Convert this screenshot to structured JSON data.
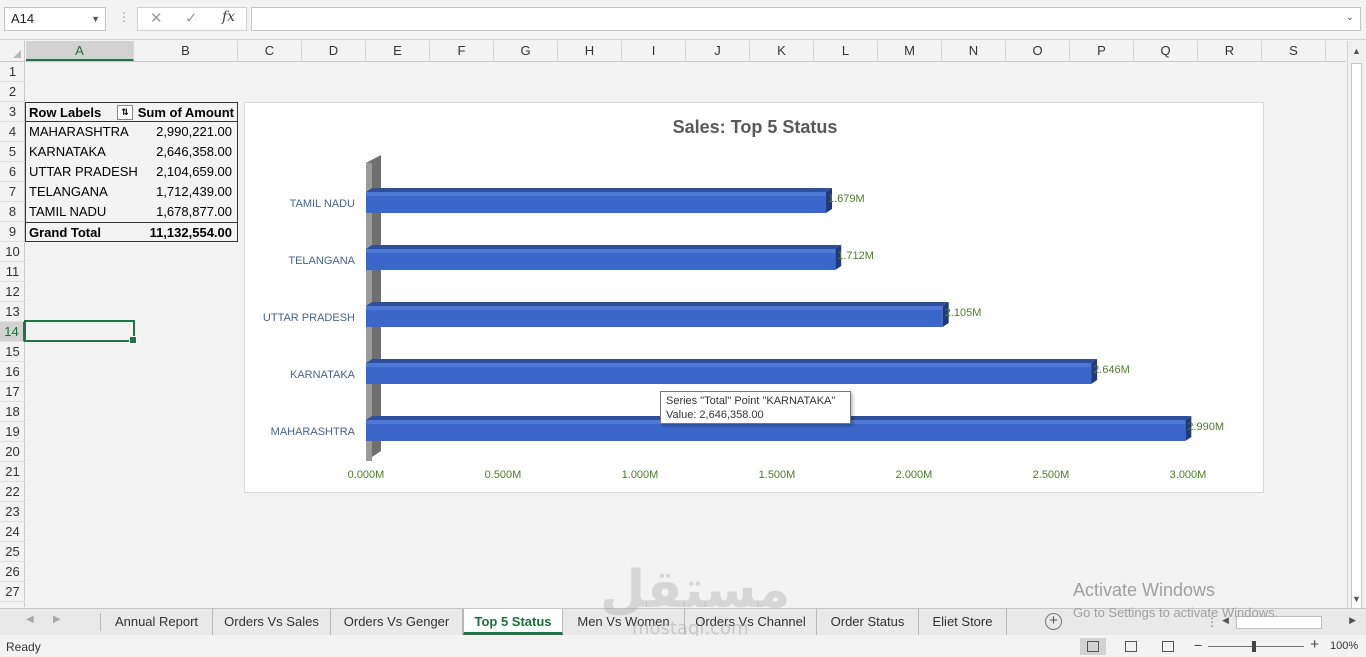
{
  "formula_bar": {
    "name_box": "A14",
    "cancel_glyph": "✕",
    "enter_glyph": "✓",
    "fx_label": "fx",
    "formula": ""
  },
  "columns": [
    "A",
    "B",
    "C",
    "D",
    "E",
    "F",
    "G",
    "H",
    "I",
    "J",
    "K",
    "L",
    "M",
    "N",
    "O",
    "P",
    "Q",
    "R",
    "S"
  ],
  "selected_column": "A",
  "rows": [
    "1",
    "2",
    "3",
    "4",
    "5",
    "6",
    "7",
    "8",
    "9",
    "10",
    "11",
    "12",
    "13",
    "14",
    "15",
    "16",
    "17",
    "18",
    "19",
    "20",
    "21",
    "22",
    "23",
    "24",
    "25",
    "26",
    "27"
  ],
  "selected_row": "14",
  "pivot": {
    "header": {
      "label": "Row Labels",
      "value": "Sum of Amount"
    },
    "rows": [
      {
        "label": "MAHARASHTRA",
        "value": "2,990,221.00"
      },
      {
        "label": "KARNATAKA",
        "value": "2,646,358.00"
      },
      {
        "label": "UTTAR PRADESH",
        "value": "2,104,659.00"
      },
      {
        "label": "TELANGANA",
        "value": "1,712,439.00"
      },
      {
        "label": "TAMIL NADU",
        "value": "1,678,877.00"
      }
    ],
    "total": {
      "label": "Grand Total",
      "value": "11,132,554.00"
    }
  },
  "chart_data": {
    "type": "bar",
    "orientation": "horizontal",
    "title": "Sales: Top 5 Status",
    "categories": [
      "TAMIL NADU",
      "TELANGANA",
      "UTTAR PRADESH",
      "KARNATAKA",
      "MAHARASHTRA"
    ],
    "series": [
      {
        "values": [
          1678877,
          1712439,
          2104659,
          2646358,
          2990221
        ]
      }
    ],
    "data_labels": [
      "1.679M",
      "1.712M",
      "2.105M",
      "2.646M",
      "2.990M"
    ],
    "x_ticks": [
      "0.000M",
      "0.500M",
      "1.000M",
      "1.500M",
      "2.000M",
      "2.500M",
      "3.000M"
    ],
    "xlim": [
      0,
      3000000
    ],
    "grid": false,
    "legend": "none",
    "colors": {
      "bar": "#3a67c9",
      "bar_top": "#2f4f9c",
      "bar_side": "#1f3a7a",
      "value_label": "#4e7b2b",
      "category_label": "#44658e"
    }
  },
  "tooltip": {
    "line1": "Series \"Total\" Point \"KARNATAKA\"",
    "line2": "Value:  2,646,358.00"
  },
  "sheet_tabs": [
    "Annual Report",
    "Orders Vs Sales",
    "Orders Vs Genger",
    "Top 5 Status",
    "Men Vs Women",
    "Orders Vs Channel",
    "Order Status",
    "Eliet Store"
  ],
  "active_tab": "Top 5 Status",
  "status": {
    "ready": "Ready",
    "zoom": "100%"
  },
  "watermark": {
    "activate_title": "Activate Windows",
    "activate_sub": "Go to Settings to activate Windows.",
    "brand_ar": "مستقل",
    "brand_url": "mostaql.com"
  },
  "accent": "#217346"
}
